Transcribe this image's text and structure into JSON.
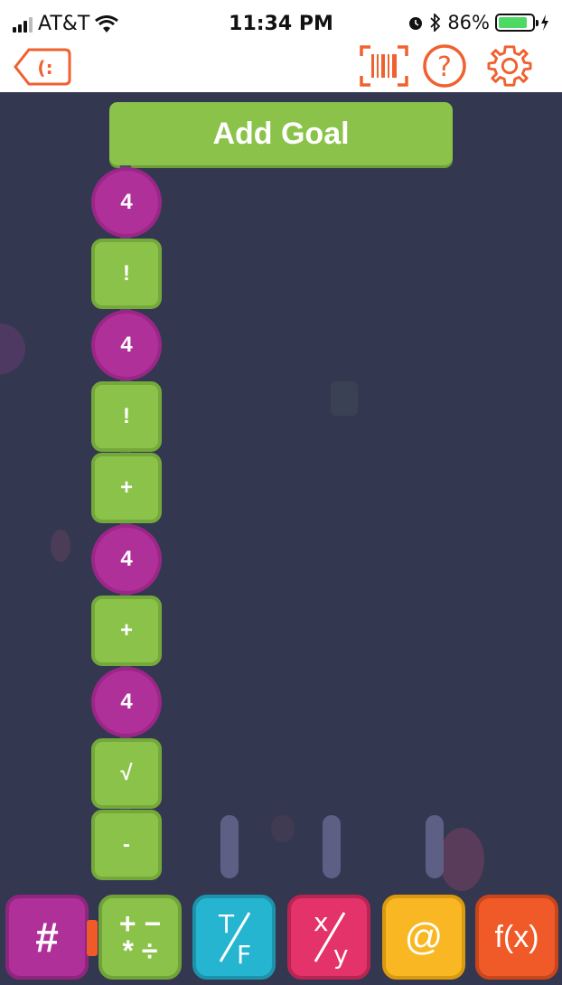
{
  "status_bar": {
    "carrier": "AT&T",
    "time": "11:34 PM",
    "battery_percent": "86%",
    "battery_level": 0.86,
    "icons": [
      "signal-icon",
      "wifi-icon",
      "alarm-icon",
      "bluetooth-icon",
      "battery-icon",
      "charging-icon"
    ]
  },
  "header": {
    "back_glyph": "(:",
    "icons": [
      "back-icon",
      "barcode-icon",
      "help-icon",
      "settings-icon"
    ],
    "accent_color": "#f0612f"
  },
  "workspace": {
    "background": "#343750",
    "add_goal_label": "Add Goal",
    "blocks": [
      {
        "kind": "num",
        "label": "4"
      },
      {
        "kind": "op",
        "label": "!"
      },
      {
        "kind": "num",
        "label": "4"
      },
      {
        "kind": "op",
        "label": "!"
      },
      {
        "kind": "op",
        "label": "+"
      },
      {
        "kind": "num",
        "label": "4"
      },
      {
        "kind": "op",
        "label": "+"
      },
      {
        "kind": "num",
        "label": "4"
      },
      {
        "kind": "op",
        "label": "√"
      },
      {
        "kind": "op",
        "label": "-"
      }
    ]
  },
  "toolbar": {
    "number_label": "#",
    "math_label": "+ − * ÷",
    "math_top": "+ −",
    "math_bottom": "* ÷",
    "logic_top": "T",
    "logic_bottom": "F",
    "fraction_top": "x",
    "fraction_bottom": "y",
    "at_label": "@",
    "function_label": "f(x)",
    "colors": {
      "number": "#b0309a",
      "math": "#8bc34a",
      "logic": "#26b5d0",
      "fraction": "#e4336a",
      "at": "#f9b823",
      "function": "#f05a28"
    }
  }
}
